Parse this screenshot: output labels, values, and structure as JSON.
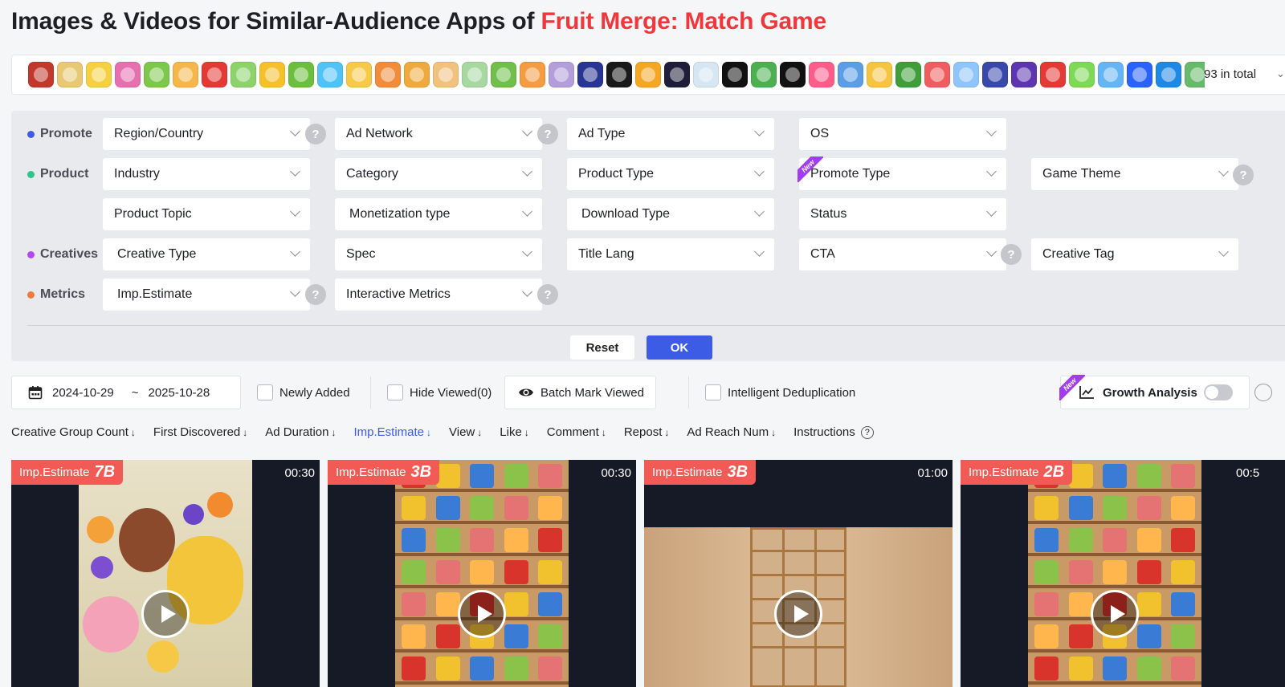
{
  "header": {
    "title_prefix": "Images & Videos for Similar-Audience Apps of ",
    "title_app": "Fruit Merge: Match Game"
  },
  "apps": {
    "total_label": "93 in total",
    "icon_colors": [
      "#c0392b",
      "#e8c872",
      "#f5d142",
      "#e66fb0",
      "#7cc84b",
      "#f6b64a",
      "#e53935",
      "#8bd36a",
      "#f5c02a",
      "#6cbf3c",
      "#4fc3f7",
      "#f7c948",
      "#f28b3a",
      "#f0a93c",
      "#f1c27d",
      "#a7d8a0",
      "#6fbf4a",
      "#f59b42",
      "#b39ddb",
      "#283593",
      "#1a1a1a",
      "#f5a623",
      "#1e1e3a",
      "#d6e6f2",
      "#111111",
      "#4caf50",
      "#111111",
      "#ff5c8a",
      "#5c9ee6",
      "#f5c542",
      "#3f9e3a",
      "#f05d5e",
      "#8ec5fc",
      "#3949ab",
      "#5e35b1",
      "#e53935",
      "#7ed957",
      "#64b5f6",
      "#2962ff",
      "#1e88e5",
      "#66bb6a"
    ]
  },
  "filters": {
    "promote": {
      "label": "Promote",
      "color": "#3c5ce5",
      "items": [
        "Region/Country",
        "Ad Network",
        "Ad Type",
        "OS"
      ]
    },
    "product": {
      "label": "Product",
      "color": "#2fc48a",
      "items": [
        "Industry",
        "Category",
        "Product Type",
        "Promote Type",
        "Game Theme"
      ],
      "items2": [
        "Product Topic",
        "Monetization type",
        "Download Type",
        "Status"
      ],
      "new_tag": "New"
    },
    "creatives": {
      "label": "Creatives",
      "color": "#b248f2",
      "items": [
        "Creative Type",
        "Spec",
        "Title Lang",
        "CTA",
        "Creative Tag"
      ]
    },
    "metrics": {
      "label": "Metrics",
      "color": "#f07a3a",
      "items": [
        "Imp.Estimate",
        "Interactive Metrics"
      ]
    },
    "help_glyph": "?",
    "reset_label": "Reset",
    "ok_label": "OK"
  },
  "toolbar": {
    "date_from": "2024-10-29",
    "date_sep": "~",
    "date_to": "2025-10-28",
    "newly_added": "Newly Added",
    "hide_viewed": "Hide Viewed(0)",
    "batch_mark": "Batch Mark Viewed",
    "dedup": "Intelligent Deduplication",
    "growth": "Growth Analysis",
    "new_tag": "New"
  },
  "sort": {
    "items": [
      "Creative Group Count",
      "First Discovered",
      "Ad Duration",
      "Imp.Estimate",
      "View",
      "Like",
      "Comment",
      "Repost",
      "Ad Reach Num"
    ],
    "active_index": 3,
    "arrow": "↓",
    "instructions": "Instructions",
    "help_glyph": "?"
  },
  "cards": [
    {
      "metric_label": "Imp.Estimate",
      "metric_value": "7B",
      "duration": "00:30"
    },
    {
      "metric_label": "Imp.Estimate",
      "metric_value": "3B",
      "duration": "00:30"
    },
    {
      "metric_label": "Imp.Estimate",
      "metric_value": "3B",
      "duration": "01:00"
    },
    {
      "metric_label": "Imp.Estimate",
      "metric_value": "2B",
      "duration": "00:5"
    }
  ]
}
